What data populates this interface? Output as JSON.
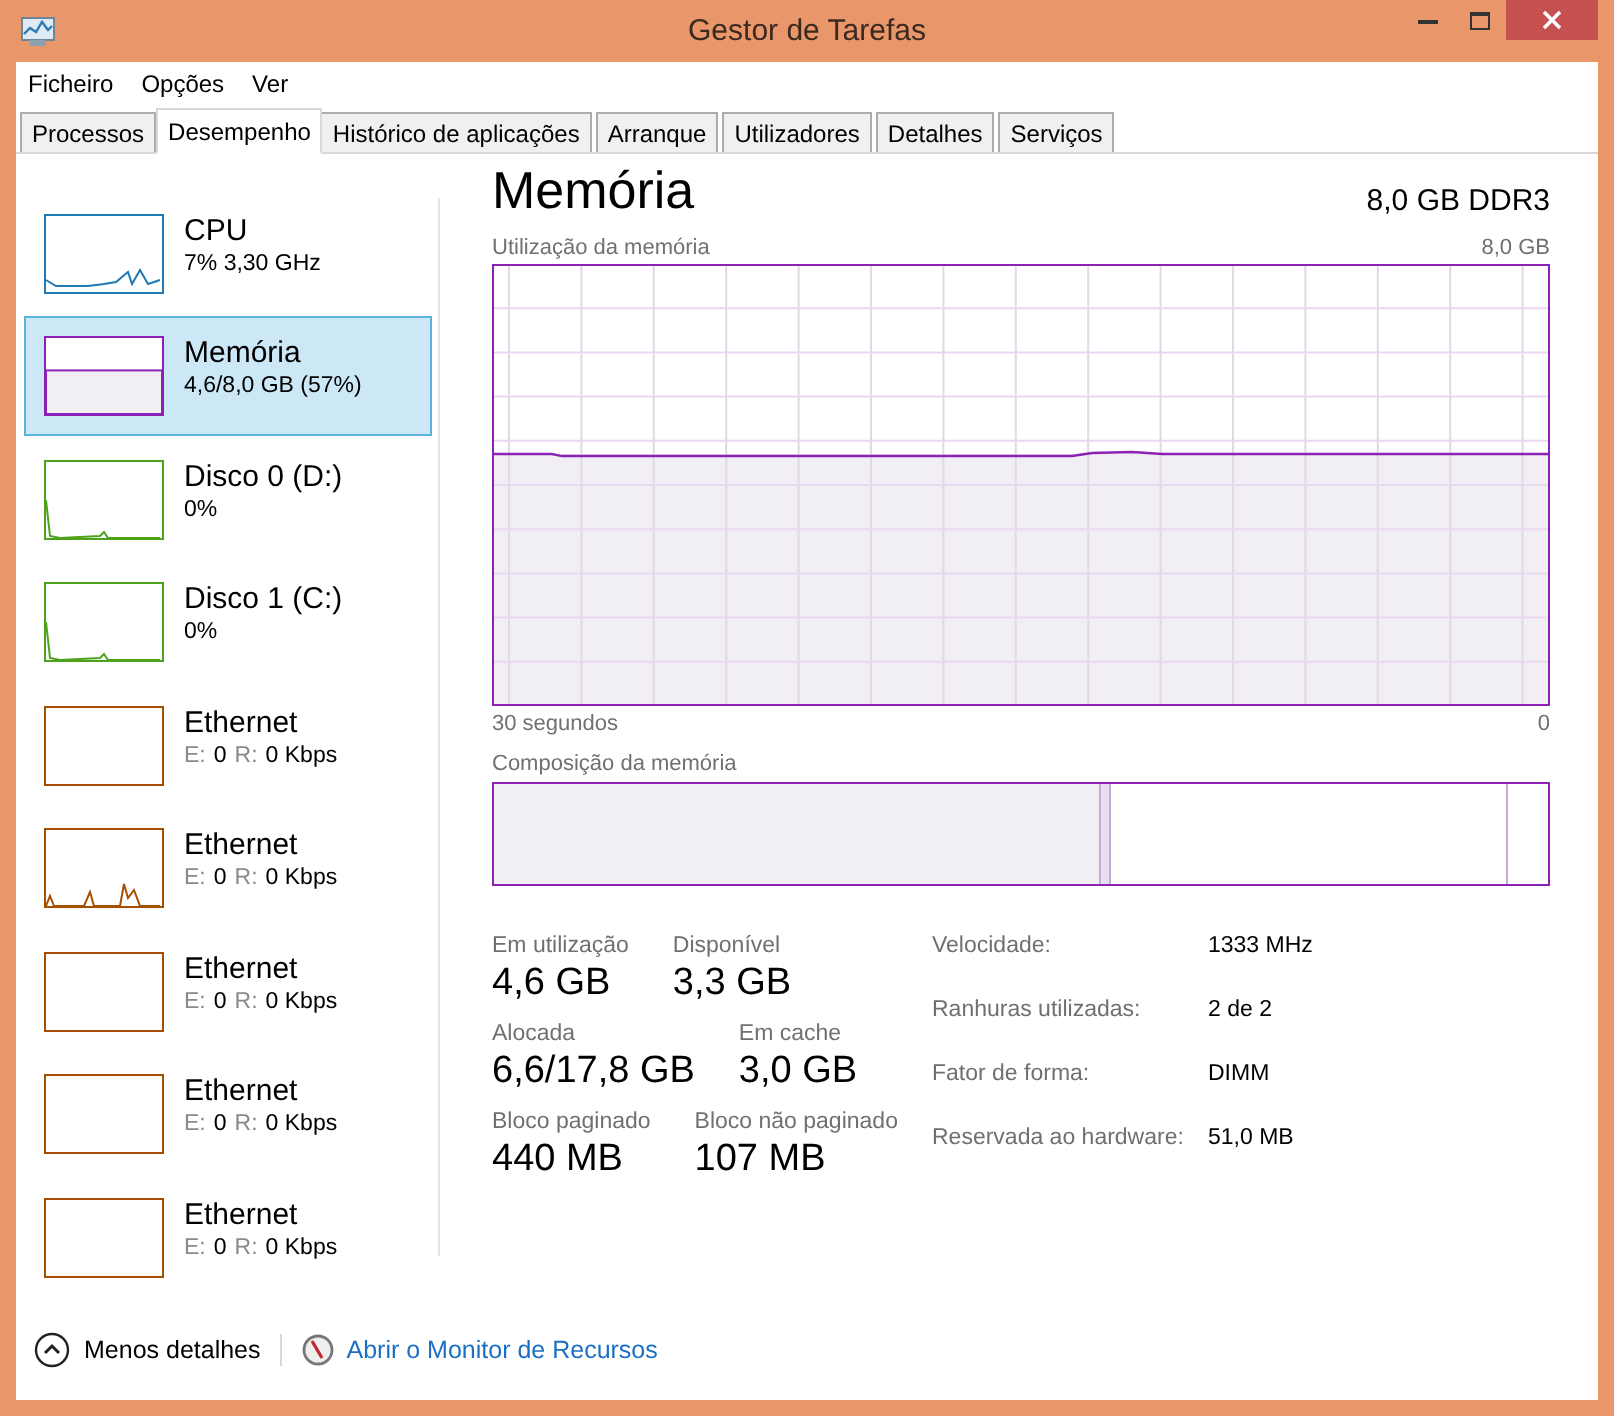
{
  "window": {
    "title": "Gestor de Tarefas"
  },
  "menu": [
    "Ficheiro",
    "Opções",
    "Ver"
  ],
  "tabs": [
    {
      "label": "Processos",
      "selected": false
    },
    {
      "label": "Desempenho",
      "selected": true
    },
    {
      "label": "Histórico de aplicações",
      "selected": false
    },
    {
      "label": "Arranque",
      "selected": false
    },
    {
      "label": "Utilizadores",
      "selected": false
    },
    {
      "label": "Detalhes",
      "selected": false
    },
    {
      "label": "Serviços",
      "selected": false
    }
  ],
  "sidebar": {
    "items": [
      {
        "kind": "cpu",
        "name": "CPU",
        "parts": [
          {
            "text": "7%  3,30 GHz",
            "muted": false
          }
        ],
        "color": "#1f7ab3",
        "selected": false,
        "activity": true
      },
      {
        "kind": "memory",
        "name": "Memória",
        "parts": [
          {
            "text": "4,6/8,0 GB (57%)",
            "muted": false
          }
        ],
        "color": "#8b22b5",
        "selected": true
      },
      {
        "kind": "disk",
        "name": "Disco 0 (D:)",
        "parts": [
          {
            "text": "0%",
            "muted": false
          }
        ],
        "color": "#4da21b",
        "selected": false,
        "activity": true
      },
      {
        "kind": "disk",
        "name": "Disco 1 (C:)",
        "parts": [
          {
            "text": "0%",
            "muted": false
          }
        ],
        "color": "#4da21b",
        "selected": false,
        "activity": true
      },
      {
        "kind": "network",
        "name": "Ethernet",
        "parts": [
          {
            "text": "E:",
            "muted": true
          },
          {
            "text": "0",
            "muted": false
          },
          {
            "text": "R:",
            "muted": true
          },
          {
            "text": "0 Kbps",
            "muted": false
          }
        ],
        "color": "#a74f01",
        "selected": false,
        "activity": false
      },
      {
        "kind": "network",
        "name": "Ethernet",
        "parts": [
          {
            "text": "E:",
            "muted": true
          },
          {
            "text": "0",
            "muted": false
          },
          {
            "text": "R:",
            "muted": true
          },
          {
            "text": "0 Kbps",
            "muted": false
          }
        ],
        "color": "#a74f01",
        "selected": false,
        "activity": true
      },
      {
        "kind": "network",
        "name": "Ethernet",
        "parts": [
          {
            "text": "E:",
            "muted": true
          },
          {
            "text": "0",
            "muted": false
          },
          {
            "text": "R:",
            "muted": true
          },
          {
            "text": "0 Kbps",
            "muted": false
          }
        ],
        "color": "#a74f01",
        "selected": false,
        "activity": false
      },
      {
        "kind": "network",
        "name": "Ethernet",
        "parts": [
          {
            "text": "E:",
            "muted": true
          },
          {
            "text": "0",
            "muted": false
          },
          {
            "text": "R:",
            "muted": true
          },
          {
            "text": "0 Kbps",
            "muted": false
          }
        ],
        "color": "#a74f01",
        "selected": false,
        "activity": false
      },
      {
        "kind": "network",
        "name": "Ethernet",
        "parts": [
          {
            "text": "E:",
            "muted": true
          },
          {
            "text": "0",
            "muted": false
          },
          {
            "text": "R:",
            "muted": true
          },
          {
            "text": "0 Kbps",
            "muted": false
          }
        ],
        "color": "#a74f01",
        "selected": false,
        "activity": false
      }
    ]
  },
  "main": {
    "title": "Memória",
    "capacity": "8,0 GB DDR3",
    "usage_graph": {
      "title": "Utilização da memória",
      "max_label": "8,0 GB",
      "time_label": "30 segundos",
      "end_label": "0"
    },
    "composition": {
      "title": "Composição da memória"
    },
    "stats": [
      [
        {
          "label": "Em utilização",
          "value": "4,6 GB"
        },
        {
          "label": "Disponível",
          "value": "3,3 GB"
        }
      ],
      [
        {
          "label": "Alocada",
          "value": "6,6/17,8 GB"
        },
        {
          "label": "Em cache",
          "value": "3,0 GB"
        }
      ],
      [
        {
          "label": "Bloco paginado",
          "value": "440 MB"
        },
        {
          "label": "Bloco não paginado",
          "value": "107 MB"
        }
      ]
    ],
    "properties": [
      {
        "label": "Velocidade:",
        "value": "1333 MHz"
      },
      {
        "label": "Ranhuras utilizadas:",
        "value": "2 de 2"
      },
      {
        "label": "Fator de forma:",
        "value": "DIMM"
      },
      {
        "label": "Reservada ao hardware:",
        "value": "51,0 MB"
      }
    ]
  },
  "footer": {
    "toggle": "Menos detalhes",
    "link": "Abrir o Monitor de Recursos"
  }
}
